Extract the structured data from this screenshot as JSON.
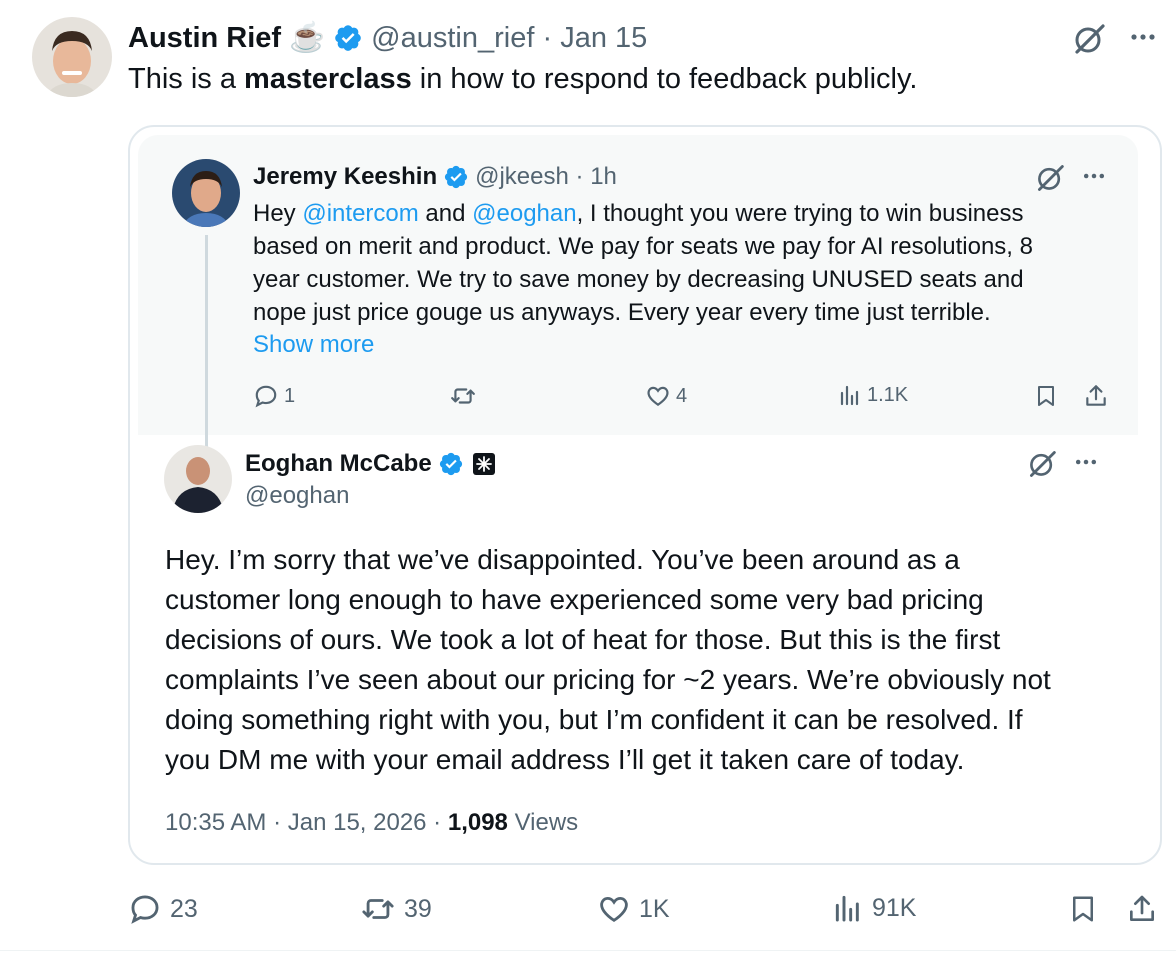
{
  "outer_tweet": {
    "author_name": "Austin Rief",
    "author_emoji": "☕",
    "handle": "@austin_rief",
    "separator": " · ",
    "date": "Jan 15",
    "text_before": "This is a ",
    "text_bold": "masterclass",
    "text_after": " in how to respond to feedback publicly.",
    "stats": {
      "replies": "23",
      "reposts": "39",
      "likes": "1K",
      "views": "91K"
    }
  },
  "quoted_thread": {
    "parent": {
      "author_name": "Jeremy Keeshin",
      "handle": "@jkeesh",
      "separator": " · ",
      "time": "1h",
      "line1_a": "Hey ",
      "mention1": "@intercom",
      "line1_b": " and ",
      "mention2": "@eoghan",
      "line1_c": ", I thought you were trying to win business",
      "line2": "based on merit and product. We pay for seats we pay for AI resolutions, 8",
      "line3": "year customer. We try to save money by decreasing UNUSED seats and",
      "line4": "nope just price gouge us anyways. Every year every time just terrible.",
      "show_more": "Show more",
      "stats": {
        "replies": "1",
        "likes": "4",
        "views": "1.1K"
      }
    },
    "reply": {
      "author_name": "Eoghan McCabe",
      "handle": "@eoghan",
      "lines": [
        "Hey. I’m sorry that we’ve disappointed. You’ve been around as a",
        "customer long enough to have experienced some very bad pricing",
        "decisions of ours. We took a lot of heat for those. But this is the first",
        "complaints I’ve seen about our pricing for ~2 years. We’re obviously not",
        "doing something right with you, but I’m confident it can be resolved. If",
        "you DM me with your email address I’ll get it taken care of today."
      ],
      "timestamp": "10:35 AM · Jan 15, 2026 · ",
      "views_count": "1,098",
      "views_label": " Views"
    }
  },
  "colors": {
    "link": "#1d9bf0",
    "muted": "#536471",
    "verified": "#1d9bf0",
    "border": "#e1e8ed"
  }
}
